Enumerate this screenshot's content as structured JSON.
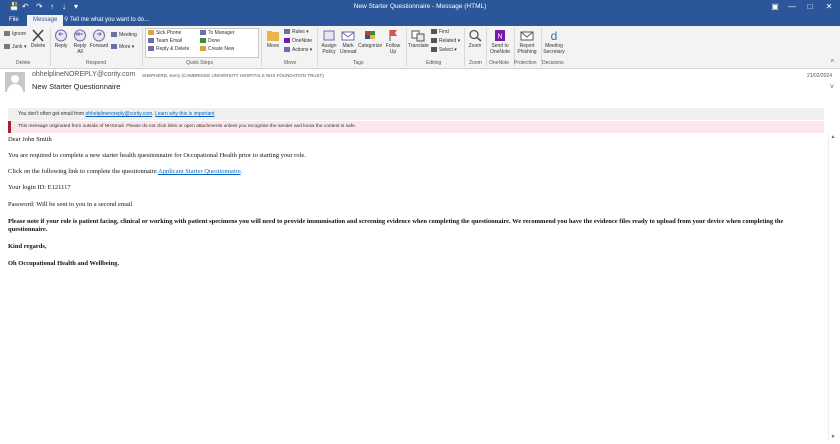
{
  "window": {
    "title": "New Starter Questionnaire  -  Message (HTML)"
  },
  "tabs": {
    "file": "File",
    "message": "Message",
    "tell_me": "Tell me what you want to do..."
  },
  "ribbon": {
    "delete_group": {
      "ignore": "Ignore",
      "junk": "Junk",
      "delete": "Delete",
      "label": "Delete"
    },
    "respond_group": {
      "reply": "Reply",
      "reply_all": "Reply All",
      "forward": "Forward",
      "meeting": "Meeting",
      "more": "More",
      "label": "Respond"
    },
    "quick_steps": {
      "items": [
        "Sick Phone",
        "Team Email",
        "Reply & Delete",
        "To Manager",
        "Done",
        "Create New"
      ],
      "label": "Quick Steps"
    },
    "move_group": {
      "move": "Move",
      "rules": "Rules",
      "onenote": "OneNote",
      "actions": "Actions",
      "label": "Move"
    },
    "tags_group": {
      "assign_policy": "Assign Policy",
      "mark_unread": "Mark Unread",
      "categorize": "Categorize",
      "follow_up": "Follow Up",
      "label": "Tags"
    },
    "editing_group": {
      "translate": "Translate",
      "find": "Find",
      "related": "Related",
      "select": "Select",
      "label": "Editing"
    },
    "zoom_group": {
      "zoom": "Zoom",
      "label": "Zoom"
    },
    "onenote_group": {
      "send_to_onenote": "Send to OneNote",
      "label": "OneNote"
    },
    "protection_group": {
      "report_phishing": "Report Phishing",
      "label": "Protection"
    },
    "decisions_group": {
      "meeting_secretary": "Meeting Secretary",
      "label": "Decisions"
    }
  },
  "message": {
    "from": "ohhelplineNOREPLY@cority.com",
    "to": "SHEPHERD, Kerry (CAMBRIDGE UNIVERSITY HOSPITALS NHS FOUNDATION TRUST)",
    "date": "21/02/2024",
    "subject": "New Starter Questionnaire",
    "info_prefix": "You don't often get email from",
    "info_email": "ohhelplinenoreply@cority.com",
    "info_link": "Learn why this is important",
    "warning": "This message originated from outside of NHSmail. Please do not click links or open attachments unless you recognise the sender and know the content is safe."
  },
  "body": {
    "greeting": "Dear John Smith",
    "p1": "You are required to complete a new starter health questionnaire for Occupational Health prior to starting your role.",
    "p2_prefix": "Click on the following link to complete the questionnaire",
    "p2_link": "Applicant Starter Questionnaire",
    "p2_suffix": ".",
    "login": "Your login ID: E121117",
    "password": "Password: Will be sent to you in a second email",
    "note": "Please note if your role is patient facing, clinical or working with patient specimens you will need to provide immunisation and screening evidence when completing the questionnaire. We recommend you have the evidence files ready to upload from your device when completing the questionnaire.",
    "regards": "Kind regards,",
    "signoff": "Oh Occupational Health and Wellbeing."
  },
  "colors": {
    "title_bar": "#2b579a",
    "ribbon": "#f3f3f3",
    "warning_accent": "#a4262c",
    "link": "#0563c1"
  }
}
